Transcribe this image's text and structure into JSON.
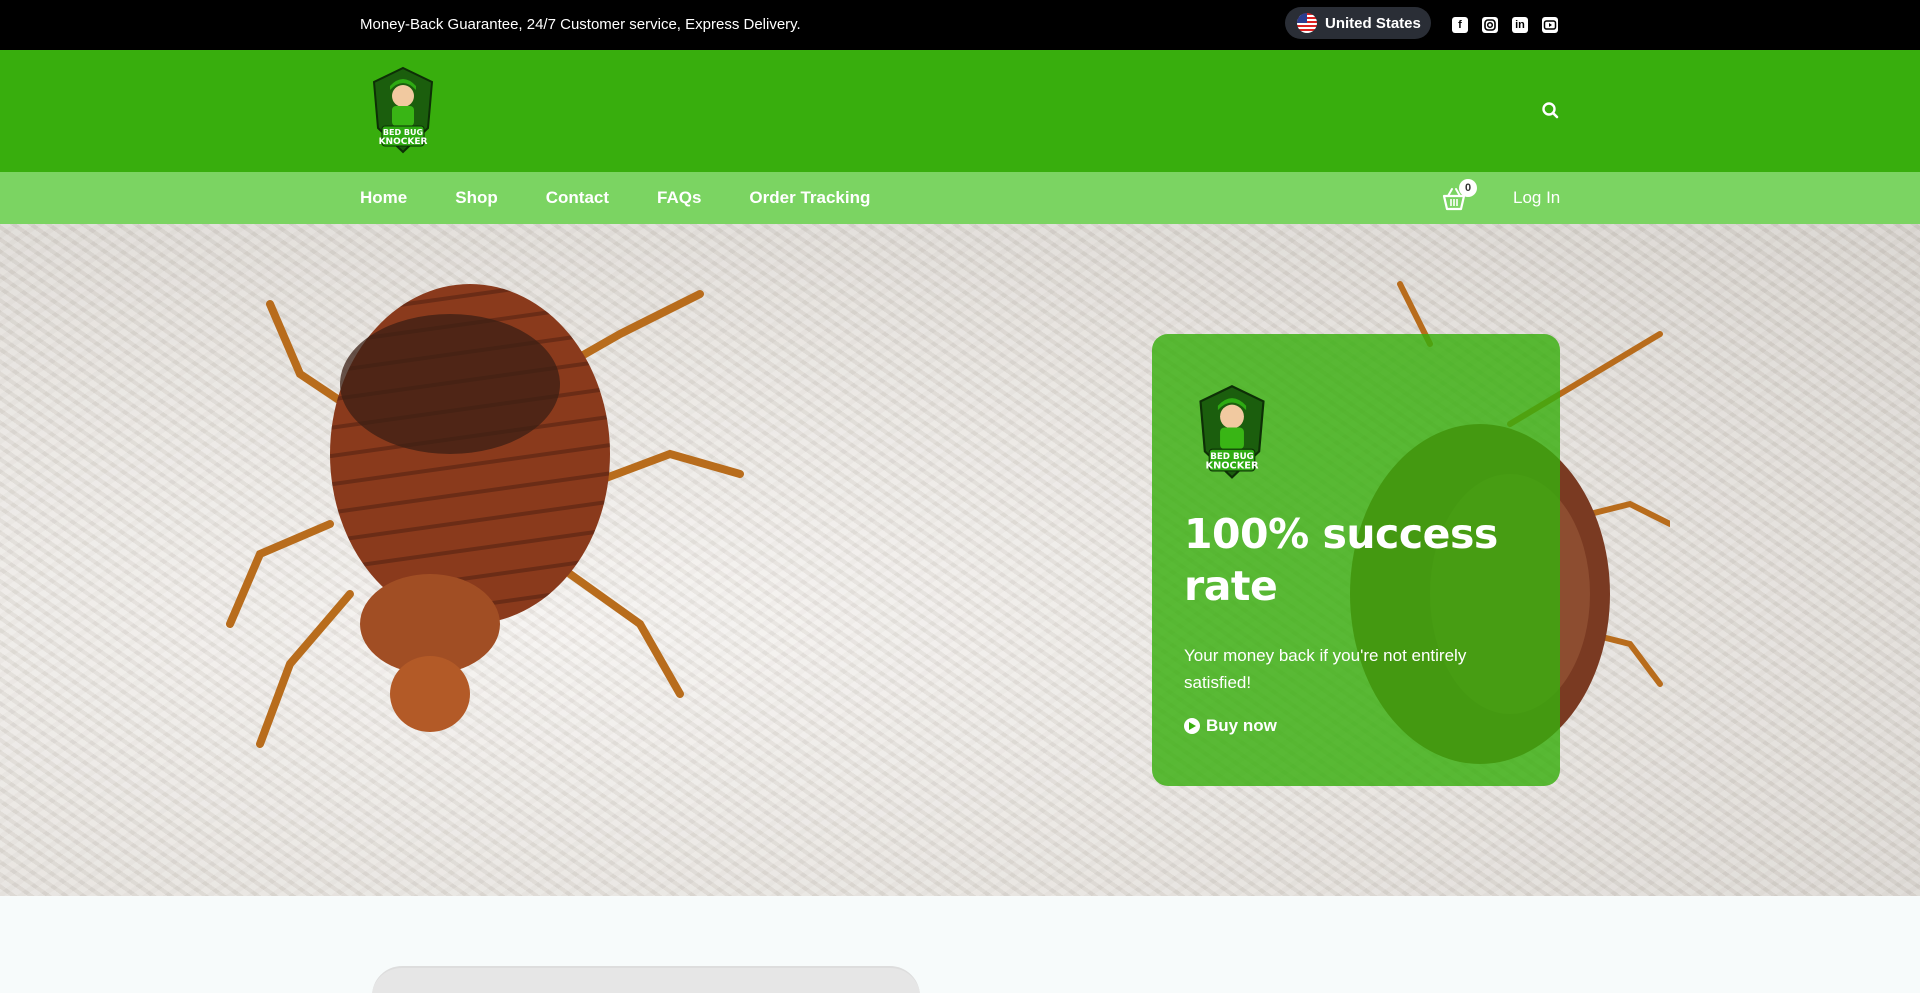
{
  "topbar": {
    "tagline": "Money-Back Guarantee, 24/7 Customer service, Express Delivery.",
    "country": "United States",
    "socials": [
      "facebook-icon",
      "instagram-icon",
      "linkedin-icon",
      "youtube-icon"
    ]
  },
  "header": {
    "logo_text": "BED BUG KNOCKER",
    "brand_color": "#38ae0d"
  },
  "nav": {
    "items": [
      "Home",
      "Shop",
      "Contact",
      "FAQs",
      "Order Tracking"
    ],
    "cart_count": "0",
    "login": "Log In",
    "color": "#7bd462"
  },
  "hero": {
    "heading": "100% success rate",
    "subtext": "Your money back if you're not entirely satisfied!",
    "cta": "Buy now"
  }
}
